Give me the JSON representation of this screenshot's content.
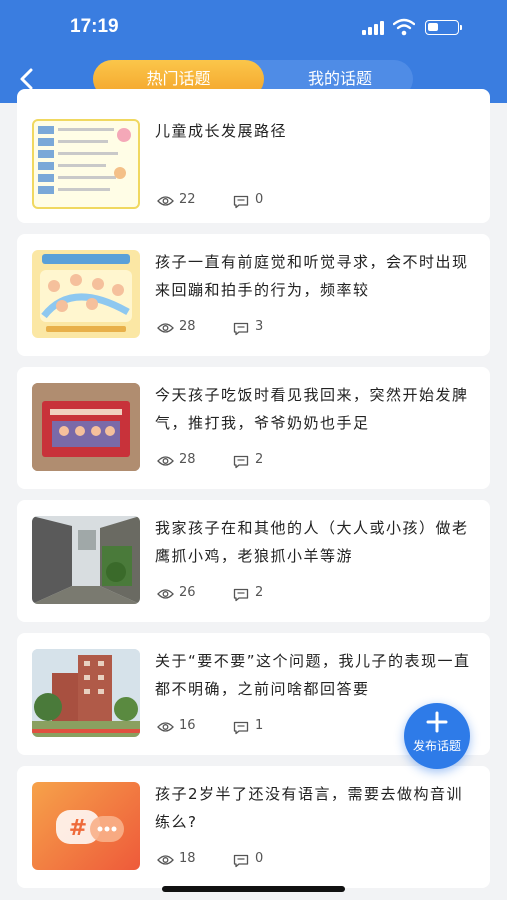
{
  "status_bar": {
    "time": "17:19"
  },
  "tabs": [
    {
      "label": "热门话题",
      "active": true
    },
    {
      "label": "我的话题",
      "active": false
    }
  ],
  "topics": [
    {
      "title": "儿童成长发展路径",
      "views": "22",
      "comments": "0",
      "thumb": "development-chart"
    },
    {
      "title": "孩子一直有前庭觉和听觉寻求，会不时出现来回蹦和拍手的行为，频率较",
      "views": "28",
      "comments": "3",
      "thumb": "cartoon-chart"
    },
    {
      "title": "今天孩子吃饭时看见我回来，突然开始发脾气，推打我，爷爷奶奶也手足",
      "views": "28",
      "comments": "2",
      "thumb": "red-book"
    },
    {
      "title": "我家孩子在和其他的人（大人或小孩）做老鹰抓小鸡，老狼抓小羊等游",
      "views": "26",
      "comments": "2",
      "thumb": "alley-photo"
    },
    {
      "title": "关于“要不要”这个问题，我儿子的表现一直都不明确，之前问啥都回答要",
      "views": "16",
      "comments": "1",
      "thumb": "building-photo"
    },
    {
      "title": "孩子2岁半了还没有语言，需要去做构音训练么?",
      "views": "18",
      "comments": "0",
      "thumb": "chat-hashtag-icon"
    }
  ],
  "fab": {
    "label": "发布话题"
  },
  "colors": {
    "header": "#3a7de0",
    "accent": "#f3a32a",
    "fab": "#2e7be8"
  }
}
